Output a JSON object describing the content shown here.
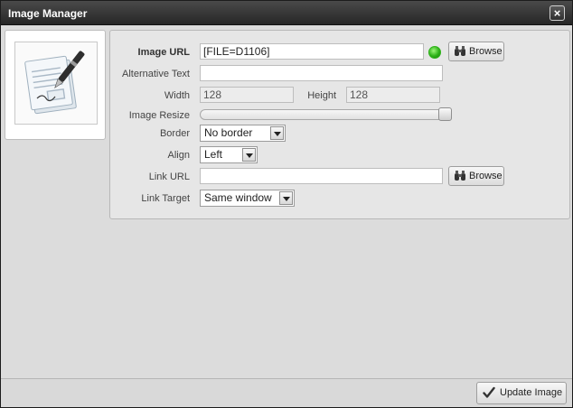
{
  "window": {
    "title": "Image Manager",
    "close_label": "×"
  },
  "form": {
    "image_url": {
      "label": "Image URL",
      "value": "[FILE=D1106]",
      "status": "valid",
      "status_color": "#2fb31a"
    },
    "browse_label": "Browse",
    "alt_text": {
      "label": "Alternative Text",
      "value": ""
    },
    "width": {
      "label": "Width",
      "value": "128"
    },
    "height": {
      "label": "Height",
      "value": "128"
    },
    "resize": {
      "label": "Image Resize",
      "value_fraction": 1.0
    },
    "border": {
      "label": "Border",
      "selected": "No border"
    },
    "align": {
      "label": "Align",
      "selected": "Left"
    },
    "link_url": {
      "label": "Link URL",
      "value": ""
    },
    "link_target": {
      "label": "Link Target",
      "selected": "Same window"
    }
  },
  "footer": {
    "update_label": "Update Image"
  },
  "icons": {
    "thumbnail": "document-pen-icon",
    "browse": "binoculars-icon",
    "update": "checkmark-icon"
  }
}
